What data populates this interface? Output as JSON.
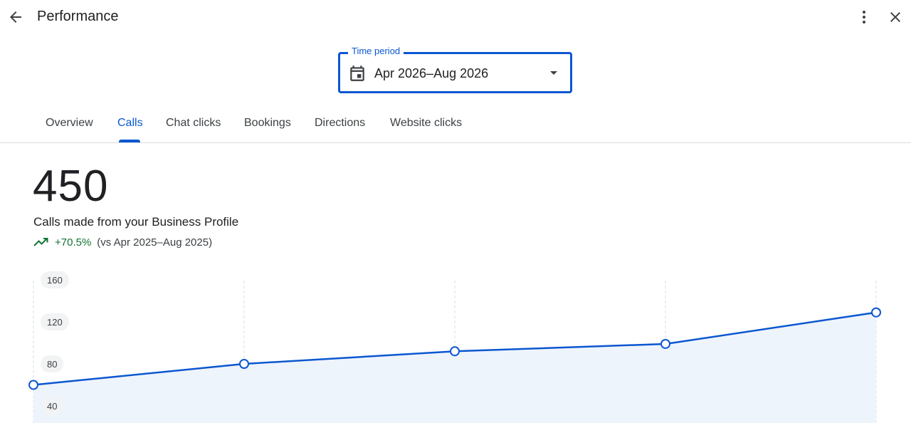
{
  "header": {
    "title": "Performance",
    "back_icon": "arrow-back-icon",
    "more_icon": "more-vert-icon",
    "close_icon": "close-icon"
  },
  "time_period": {
    "label": "Time period",
    "value": "Apr 2026–Aug 2026",
    "icon": "calendar-icon"
  },
  "tabs": [
    {
      "label": "Overview",
      "active": false
    },
    {
      "label": "Calls",
      "active": true
    },
    {
      "label": "Chat clicks",
      "active": false
    },
    {
      "label": "Bookings",
      "active": false
    },
    {
      "label": "Directions",
      "active": false
    },
    {
      "label": "Website clicks",
      "active": false
    }
  ],
  "metric": {
    "value": "450",
    "description": "Calls made from your Business Profile",
    "change": "+70.5%",
    "comparison": "(vs Apr 2025–Aug 2025)"
  },
  "colors": {
    "accent": "#0b57d0",
    "positive": "#137333",
    "area_fill": "#eef4fc"
  },
  "chart_data": {
    "type": "area",
    "x": [
      1,
      2,
      3,
      4,
      5
    ],
    "values": [
      60,
      80,
      92,
      99,
      129
    ],
    "yticks": [
      "160",
      "120",
      "80",
      "40"
    ],
    "ytick_values": [
      160,
      120,
      80,
      40
    ],
    "ylim": [
      0,
      160
    ],
    "grid": "vertical-dashed"
  }
}
